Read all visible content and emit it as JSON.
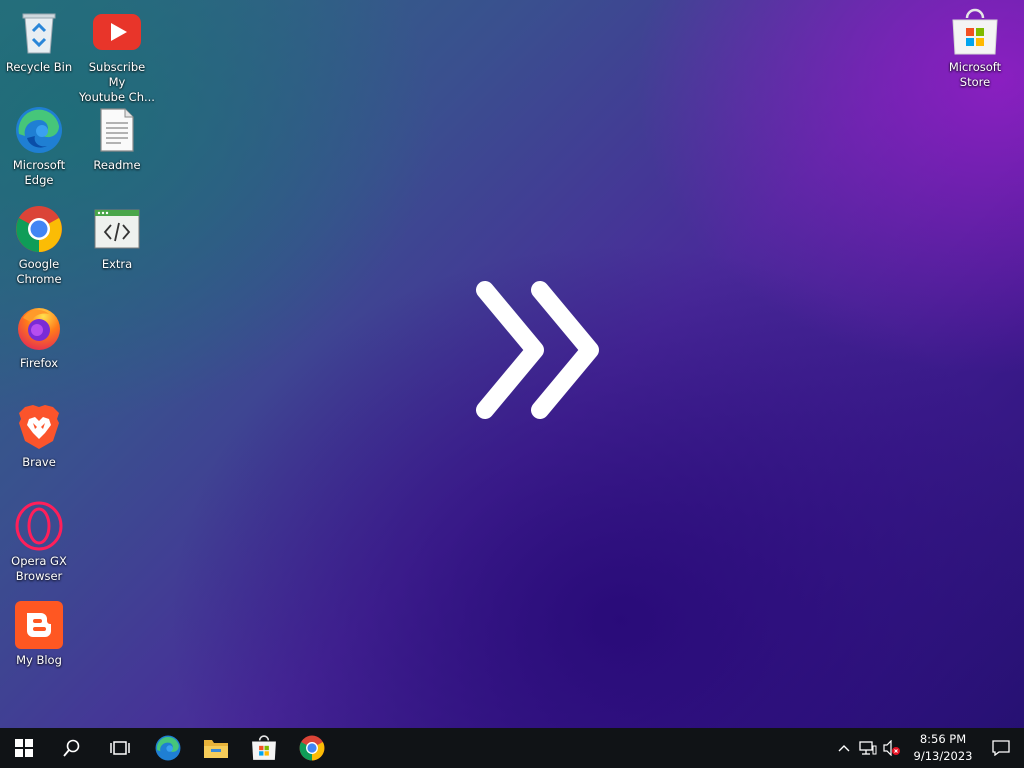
{
  "desktop": {
    "icons": [
      {
        "label": "Recycle Bin",
        "icon": "recycle-bin-icon"
      },
      {
        "label": "Subscribe My\nYoutube Ch...",
        "icon": "youtube-icon"
      },
      {
        "label": "Microsoft\nEdge",
        "icon": "edge-icon"
      },
      {
        "label": "Readme",
        "icon": "text-document-icon"
      },
      {
        "label": "Google\nChrome",
        "icon": "chrome-icon"
      },
      {
        "label": "Extra",
        "icon": "code-window-icon"
      },
      {
        "label": "Firefox",
        "icon": "firefox-icon"
      },
      {
        "label": "Brave",
        "icon": "brave-icon"
      },
      {
        "label": "Opera GX\nBrowser",
        "icon": "opera-gx-icon"
      },
      {
        "label": "My Blog",
        "icon": "blogger-icon"
      },
      {
        "label": "Microsoft\nStore",
        "icon": "microsoft-store-icon"
      }
    ],
    "wallpaper_logo": "double-chevron-icon"
  },
  "taskbar": {
    "pinned": [
      "start-icon",
      "search-icon",
      "task-view-icon",
      "edge-icon",
      "file-explorer-icon",
      "microsoft-store-icon",
      "chrome-icon"
    ],
    "tray": [
      "chevron-up-icon",
      "network-icon",
      "volume-muted-icon"
    ],
    "clock": {
      "time": "8:56 PM",
      "date": "9/13/2023"
    },
    "notification": "notification-icon"
  },
  "colors": {
    "taskbar": "#101316",
    "accent": "#7a1fb8"
  }
}
